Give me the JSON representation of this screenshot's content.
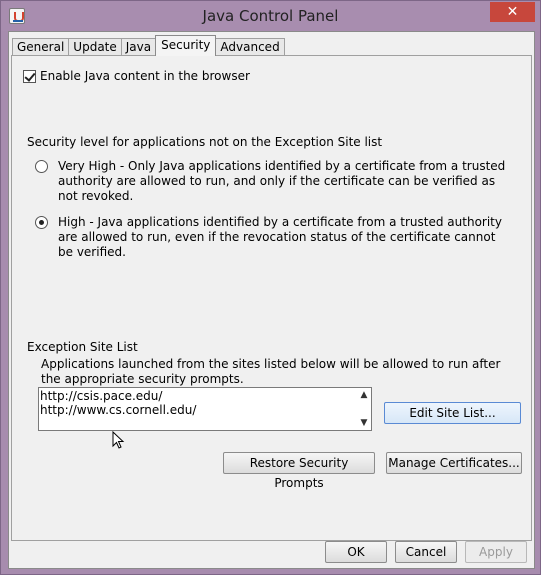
{
  "window": {
    "title": "Java Control Panel",
    "close_glyph": "✕"
  },
  "tabs": [
    {
      "label": "General"
    },
    {
      "label": "Update"
    },
    {
      "label": "Java"
    },
    {
      "label": "Security",
      "active": true
    },
    {
      "label": "Advanced"
    }
  ],
  "security": {
    "enable_label": "Enable Java content in the browser",
    "enable_checked": true,
    "level_heading": "Security level for applications not on the Exception Site list",
    "options": [
      {
        "label": "Very High - Only Java applications identified by a certificate from a trusted authority are allowed to run, and only if the certificate can be verified as not revoked.",
        "selected": false
      },
      {
        "label": "High - Java applications identified by a certificate from a trusted authority are allowed to run, even if the revocation status of the certificate cannot be verified.",
        "selected": true
      }
    ]
  },
  "exception": {
    "heading": "Exception Site List",
    "description": "Applications launched from the sites listed below will be allowed to run after the appropriate security prompts.",
    "sites": [
      "http://csis.pace.edu/",
      "http://www.cs.cornell.edu/"
    ],
    "edit_button": "Edit Site List..."
  },
  "buttons": {
    "restore": "Restore Security Prompts",
    "manage": "Manage Certificates...",
    "ok": "OK",
    "cancel": "Cancel",
    "apply": "Apply"
  },
  "icons": {
    "scroll_up": "▲",
    "scroll_down": "▼"
  }
}
